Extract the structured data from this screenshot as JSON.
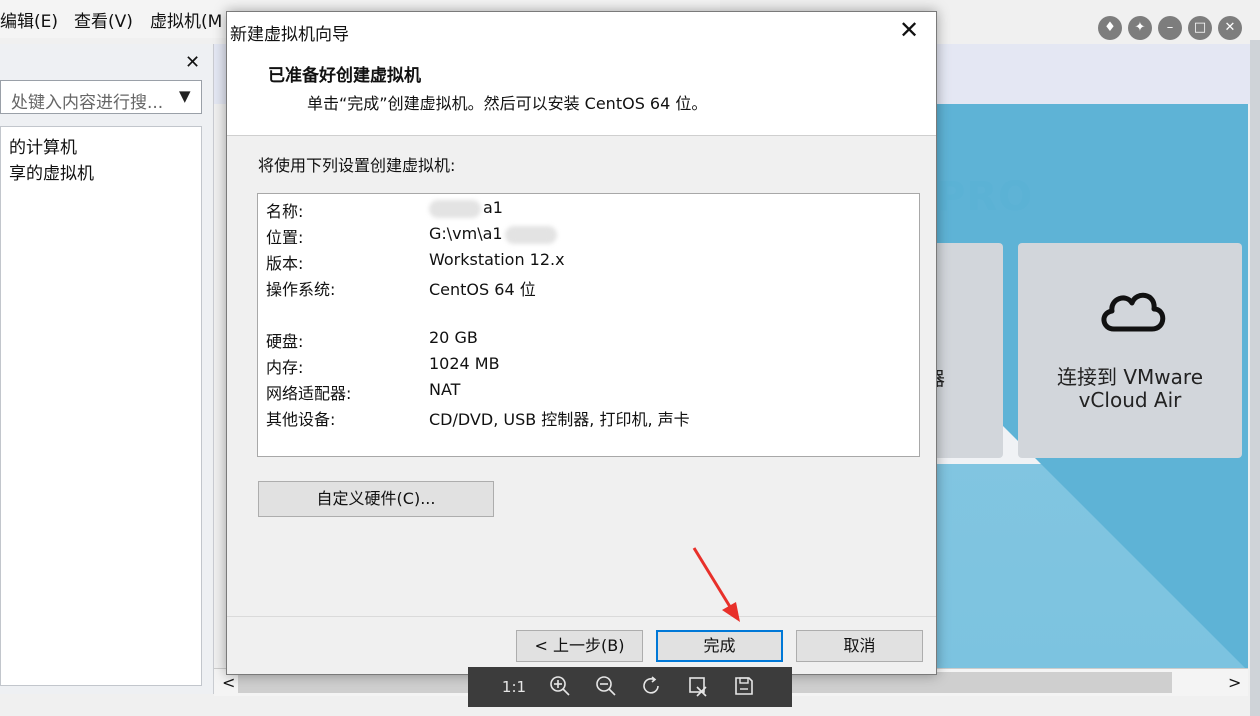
{
  "background": {
    "menu": {
      "edit": "编辑(E)",
      "view": "查看(V)",
      "vm": "虚拟机(M"
    },
    "library": {
      "search_placeholder": "处键入内容进行搜...",
      "tree": [
        "的计算机",
        "享的虚拟机"
      ]
    },
    "home": {
      "pro_text": "PRO",
      "left_card_label": "器",
      "vcloud_line1": "连接到 VMware",
      "vcloud_line2": "vCloud Air"
    }
  },
  "wizard": {
    "title": "新建虚拟机向导",
    "header_title": "已准备好创建虚拟机",
    "header_subtitle": "单击“完成”创建虚拟机。然后可以安装 CentOS 64 位。",
    "intro": "将使用下列设置创建虚拟机:",
    "settings": {
      "name_label": "名称:",
      "name_value": "a1",
      "location_label": "位置:",
      "location_value": "G:\\vm\\a1",
      "version_label": "版本:",
      "version_value": "Workstation 12.x",
      "os_label": "操作系统:",
      "os_value": "CentOS 64 位",
      "disk_label": "硬盘:",
      "disk_value": "20 GB",
      "memory_label": "内存:",
      "memory_value": "1024 MB",
      "network_label": "网络适配器:",
      "network_value": "NAT",
      "other_label": "其他设备:",
      "other_value": "CD/DVD, USB 控制器, 打印机, 声卡"
    },
    "customize_button": "自定义硬件(C)...",
    "back_button": "< 上一步(B)",
    "finish_button": "完成",
    "cancel_button": "取消"
  },
  "viewer_toolbar": {
    "actual_size": "1:1"
  },
  "colors": {
    "accent": "#0078d7",
    "annotation": "#e8302a"
  }
}
